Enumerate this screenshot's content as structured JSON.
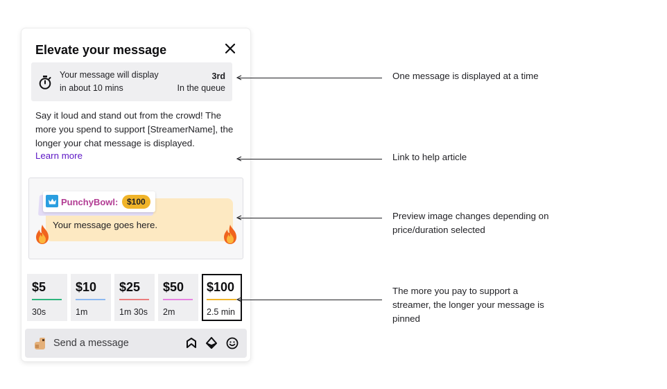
{
  "panel": {
    "title": "Elevate your message",
    "close_icon": "close-icon",
    "queue": {
      "line1": "Your message will display",
      "line2": "in about 10 mins",
      "position": "3rd",
      "position_label": "In the queue"
    },
    "description": "Say it loud and stand out from the crowd! The more you spend to support [StreamerName], the longer your chat message is displayed.",
    "learn_more": "Learn more",
    "preview": {
      "username": "PunchyBowl:",
      "amount": "$100",
      "message": "Your message goes here."
    },
    "tiers": [
      {
        "price": "$5",
        "duration": "30s",
        "color": "#2db47d"
      },
      {
        "price": "$10",
        "duration": "1m",
        "color": "#8cb8f0"
      },
      {
        "price": "$25",
        "duration": "1m 30s",
        "color": "#eb7d7d"
      },
      {
        "price": "$50",
        "duration": "2m",
        "color": "#e681e0"
      },
      {
        "price": "$100",
        "duration": "2.5 min",
        "color": "#f0b42a",
        "selected": true
      }
    ],
    "chat": {
      "placeholder": "Send a message"
    }
  },
  "annotations": [
    {
      "text": "One message is displayed at a time"
    },
    {
      "text": "Link to help article"
    },
    {
      "text": "Preview image changes depending on price/duration selected"
    },
    {
      "text": "The more you pay to support a streamer, the longer your message is pinned"
    }
  ],
  "colors": {
    "accent_purple": "#5c16c5",
    "username": "#b23c93",
    "badge": "#f0b42a",
    "bubble": "#fde9c2"
  }
}
